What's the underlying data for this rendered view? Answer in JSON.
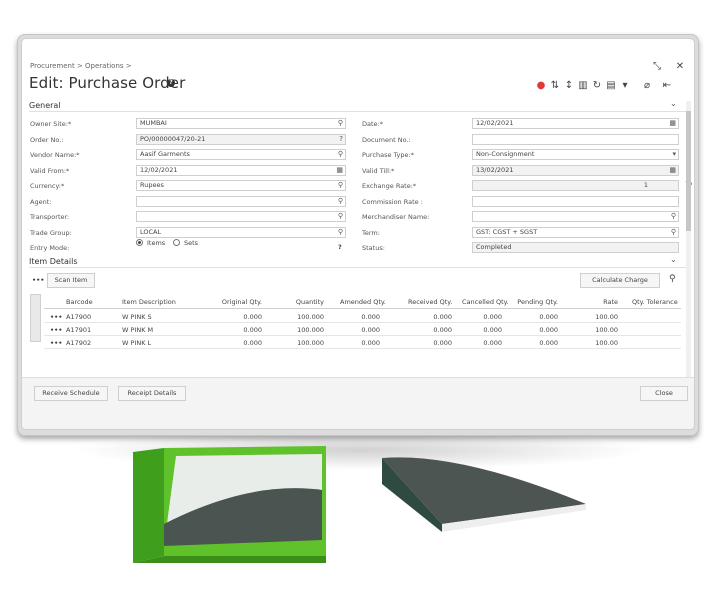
{
  "breadcrumb": "Procurement > Operations >",
  "title": "Edit: Purchase Order",
  "window": {
    "minimize": "⤡",
    "close": "✕"
  },
  "sections": {
    "general": "General",
    "items": "Item Details"
  },
  "left_fields": [
    {
      "label": "Owner Site:*",
      "value": "MUMBAI",
      "icon": "search-icon"
    },
    {
      "label": "Order No.:",
      "value": "PO/00000047/20-21",
      "icon": "help-icon"
    },
    {
      "label": "Vendor Name:*",
      "value": "Aasif Garments",
      "icon": "search-icon"
    },
    {
      "label": "Valid From:*",
      "value": "12/02/2021",
      "icon": "calendar-icon"
    },
    {
      "label": "Currency:*",
      "value": "Rupees",
      "icon": "search-icon"
    },
    {
      "label": "Agent:",
      "value": "",
      "icon": "search-icon"
    },
    {
      "label": "Transporter:",
      "value": "",
      "icon": "search-icon"
    },
    {
      "label": "Trade Group:",
      "value": "LOCAL",
      "icon": "search-icon"
    },
    {
      "label": "Entry Mode:",
      "value": "",
      "icon": "help-icon"
    }
  ],
  "entry_mode": {
    "opt1": "Items",
    "opt2": "Sets"
  },
  "right_fields": [
    {
      "label": "Date:*",
      "value": "12/02/2021",
      "icon": "calendar-icon"
    },
    {
      "label": "Document No.:",
      "value": "",
      "icon": ""
    },
    {
      "label": "Purchase Type:*",
      "value": "Non-Consignment",
      "icon": "dropdown-icon"
    },
    {
      "label": "Valid Till:*",
      "value": "13/02/2021",
      "icon": "calendar-icon"
    },
    {
      "label": "Exchange Rate:*",
      "value": "1",
      "icon": "refresh-icon"
    },
    {
      "label": "Commission Rate :",
      "value": "",
      "icon": ""
    },
    {
      "label": "Merchandiser Name:",
      "value": "",
      "icon": "search-icon"
    },
    {
      "label": "Term:",
      "value": "GST: CGST + SGST",
      "icon": "search-icon"
    },
    {
      "label": "Status:",
      "value": "Completed",
      "icon": ""
    }
  ],
  "grid": {
    "more": "•••",
    "scan_item": "Scan Item",
    "calculate_charge": "Calculate Charge",
    "headers": [
      "Barcode",
      "Item Description",
      "Original Qty.",
      "Quantity",
      "Amended Qty.",
      "Received Qty.",
      "Cancelled Qty.",
      "Pending Qty.",
      "Rate",
      "Qty. Tolerance"
    ],
    "rows": [
      [
        "A17900",
        "W PINK S",
        "0.000",
        "100.000",
        "0.000",
        "0.000",
        "0.000",
        "0.000",
        "100.00",
        ""
      ],
      [
        "A17901",
        "W PINK M",
        "0.000",
        "100.000",
        "0.000",
        "0.000",
        "0.000",
        "0.000",
        "100.00",
        ""
      ],
      [
        "A17902",
        "W PINK L",
        "0.000",
        "100.000",
        "0.000",
        "0.000",
        "0.000",
        "0.000",
        "100.00",
        ""
      ]
    ]
  },
  "footer": {
    "receive_schedule": "Receive Schedule",
    "receipt_details": "Receipt Details",
    "close": "Close"
  },
  "colors": {
    "green": "#5fc22a",
    "dark_green": "#2f4a41",
    "grey_wedge": "#4d5552"
  }
}
